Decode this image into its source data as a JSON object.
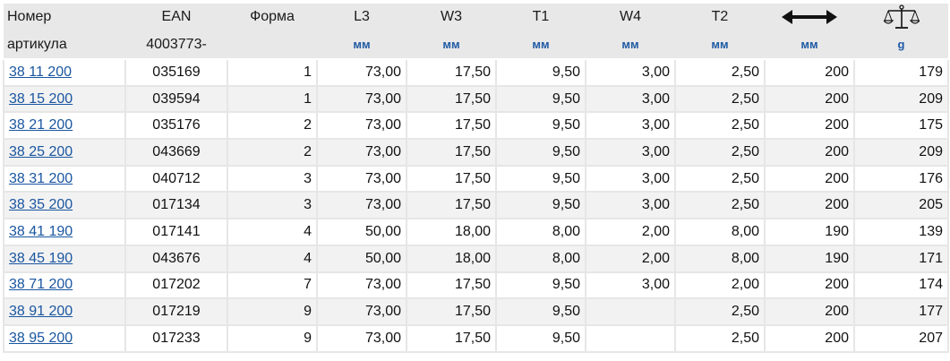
{
  "headers": {
    "article_line1": "Номер",
    "article_line2": "артикула",
    "ean_line1": "EAN",
    "ean_line2": "4003773-",
    "form": "Форма",
    "l3": "L3",
    "w3": "W3",
    "t1": "T1",
    "w4": "W4",
    "t2": "T2",
    "length_icon": "double-arrow-icon",
    "weight_icon": "scale-icon"
  },
  "units": {
    "l3": "мм",
    "w3": "мм",
    "t1": "мм",
    "w4": "мм",
    "t2": "мм",
    "length": "мм",
    "weight": "g"
  },
  "rows": [
    {
      "article": "38 11 200",
      "ean": "035169",
      "form": "1",
      "l3": "73,00",
      "w3": "17,50",
      "t1": "9,50",
      "w4": "3,00",
      "t2": "2,50",
      "length": "200",
      "weight": "179"
    },
    {
      "article": "38 15 200",
      "ean": "039594",
      "form": "1",
      "l3": "73,00",
      "w3": "17,50",
      "t1": "9,50",
      "w4": "3,00",
      "t2": "2,50",
      "length": "200",
      "weight": "209"
    },
    {
      "article": "38 21 200",
      "ean": "035176",
      "form": "2",
      "l3": "73,00",
      "w3": "17,50",
      "t1": "9,50",
      "w4": "3,00",
      "t2": "2,50",
      "length": "200",
      "weight": "175"
    },
    {
      "article": "38 25 200",
      "ean": "043669",
      "form": "2",
      "l3": "73,00",
      "w3": "17,50",
      "t1": "9,50",
      "w4": "3,00",
      "t2": "2,50",
      "length": "200",
      "weight": "209"
    },
    {
      "article": "38 31 200",
      "ean": "040712",
      "form": "3",
      "l3": "73,00",
      "w3": "17,50",
      "t1": "9,50",
      "w4": "3,00",
      "t2": "2,50",
      "length": "200",
      "weight": "176"
    },
    {
      "article": "38 35 200",
      "ean": "017134",
      "form": "3",
      "l3": "73,00",
      "w3": "17,50",
      "t1": "9,50",
      "w4": "3,00",
      "t2": "2,50",
      "length": "200",
      "weight": "205"
    },
    {
      "article": "38 41 190",
      "ean": "017141",
      "form": "4",
      "l3": "50,00",
      "w3": "18,00",
      "t1": "8,00",
      "w4": "2,00",
      "t2": "8,00",
      "length": "190",
      "weight": "139"
    },
    {
      "article": "38 45 190",
      "ean": "043676",
      "form": "4",
      "l3": "50,00",
      "w3": "18,00",
      "t1": "8,00",
      "w4": "2,00",
      "t2": "8,00",
      "length": "190",
      "weight": "171"
    },
    {
      "article": "38 71 200",
      "ean": "017202",
      "form": "7",
      "l3": "73,00",
      "w3": "17,50",
      "t1": "9,50",
      "w4": "3,00",
      "t2": "2,00",
      "length": "200",
      "weight": "174"
    },
    {
      "article": "38 91 200",
      "ean": "017219",
      "form": "9",
      "l3": "73,00",
      "w3": "17,50",
      "t1": "9,50",
      "w4": "",
      "t2": "2,50",
      "length": "200",
      "weight": "177"
    },
    {
      "article": "38 95 200",
      "ean": "017233",
      "form": "9",
      "l3": "73,00",
      "w3": "17,50",
      "t1": "9,50",
      "w4": "",
      "t2": "2,50",
      "length": "200",
      "weight": "207"
    }
  ]
}
